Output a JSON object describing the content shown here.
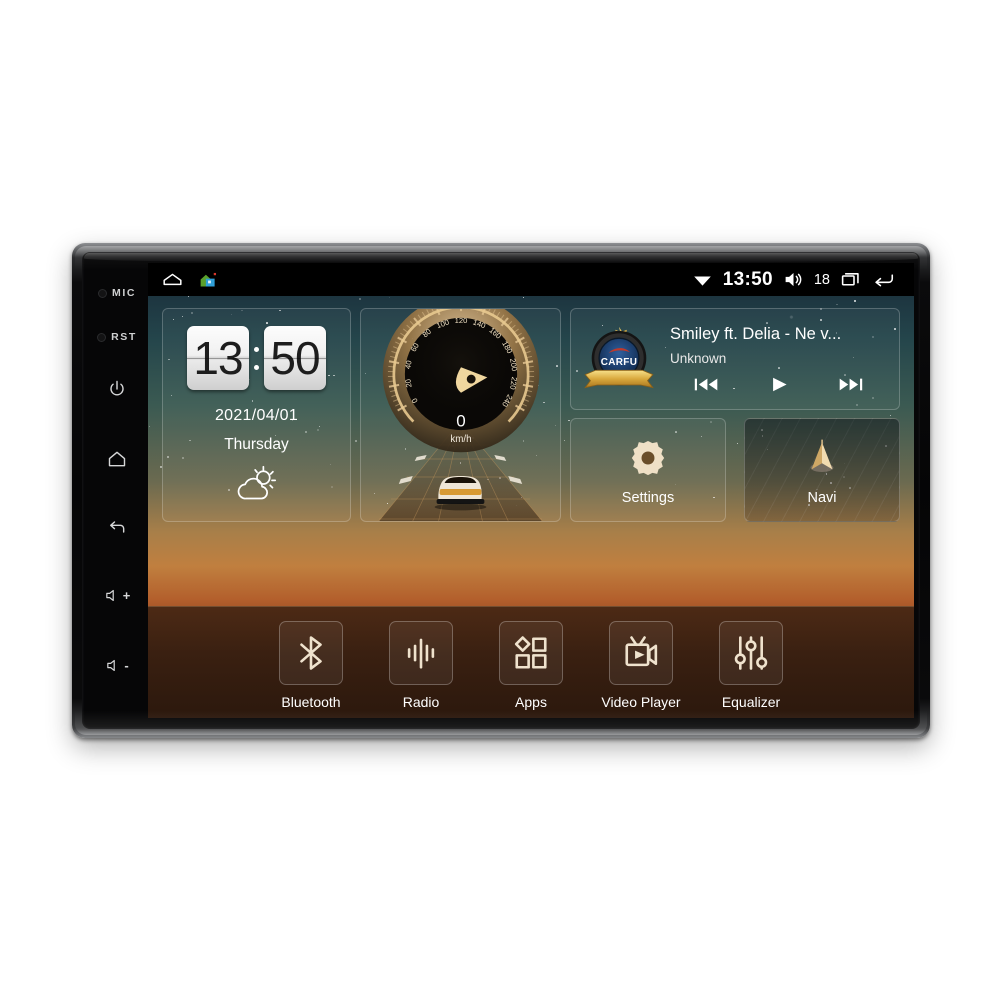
{
  "device": {
    "rail": [
      {
        "name": "mic",
        "label": "MIC",
        "type": "text-hole"
      },
      {
        "name": "reset",
        "label": "RST",
        "type": "text-hole"
      },
      {
        "name": "power",
        "label": "",
        "type": "icon",
        "icon": "power-icon"
      },
      {
        "name": "home",
        "label": "",
        "type": "icon",
        "icon": "home-icon"
      },
      {
        "name": "back",
        "label": "",
        "type": "icon",
        "icon": "back-icon"
      },
      {
        "name": "volume-up",
        "label": "+",
        "type": "icon",
        "icon": "volume-up-icon"
      },
      {
        "name": "volume-down",
        "label": "-",
        "type": "icon",
        "icon": "volume-down-icon"
      }
    ]
  },
  "statusbar": {
    "left_icons": [
      {
        "name": "home-outline-icon"
      },
      {
        "name": "house-app-icon"
      }
    ],
    "wifi_icon": "wifi-icon",
    "time": "13:50",
    "volume_icon": "volume-icon",
    "volume_level": "18",
    "recents_icon": "recents-icon",
    "back_icon": "back-arrow-icon"
  },
  "clock_widget": {
    "hours": "13",
    "minutes": "50",
    "date": "2021/04/01",
    "weekday": "Thursday",
    "weather_icon": "partly-cloudy-icon"
  },
  "speedometer": {
    "value": "0",
    "unit": "km/h",
    "ticks": [
      "0",
      "20",
      "40",
      "60",
      "80",
      "100",
      "120",
      "140",
      "160",
      "180",
      "200",
      "220",
      "240"
    ],
    "min": 0,
    "max": 240
  },
  "music": {
    "badge_text": "CARFU",
    "track": "Smiley ft. Delia - Ne v...",
    "artist": "Unknown",
    "controls": [
      {
        "name": "previous-track-button",
        "icon": "previous-icon"
      },
      {
        "name": "play-button",
        "icon": "play-icon"
      },
      {
        "name": "next-track-button",
        "icon": "next-icon"
      }
    ]
  },
  "tiles": [
    {
      "name": "settings-tile",
      "label": "Settings",
      "icon": "gear-icon"
    },
    {
      "name": "navi-tile",
      "label": "Navi",
      "icon": "navigation-arrow-icon"
    }
  ],
  "dock": [
    {
      "name": "bluetooth",
      "label": "Bluetooth",
      "icon": "bluetooth-icon"
    },
    {
      "name": "radio",
      "label": "Radio",
      "icon": "radio-waves-icon"
    },
    {
      "name": "apps",
      "label": "Apps",
      "icon": "apps-grid-icon"
    },
    {
      "name": "video-player",
      "label": "Video Player",
      "icon": "video-camera-icon"
    },
    {
      "name": "equalizer",
      "label": "Equalizer",
      "icon": "equalizer-sliders-icon"
    }
  ],
  "colors": {
    "accent_gold": "#e3c089",
    "sky_top": "#1d3540",
    "sunset": "#c07f3f",
    "dock_base": "#3a2011",
    "text": "#ffffff"
  }
}
